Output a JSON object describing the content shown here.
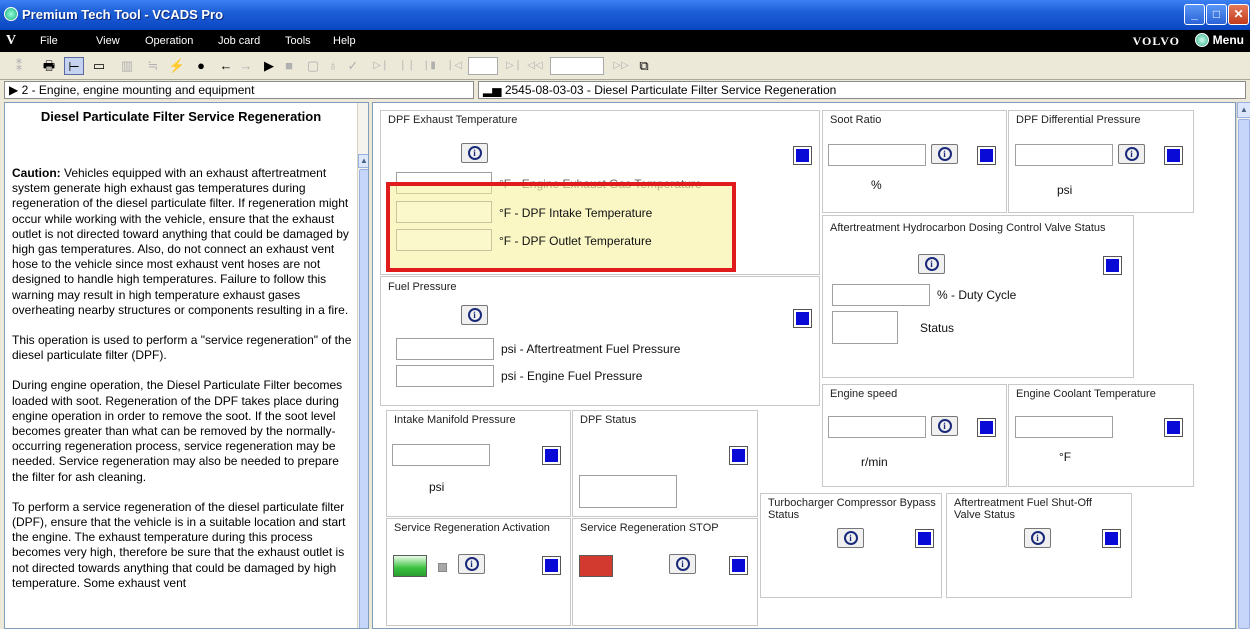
{
  "window": {
    "title": "Premium Tech Tool - VCADS Pro",
    "controls": {
      "minimize": "_",
      "maximize": "□",
      "close": "✕"
    }
  },
  "menubar": {
    "logo": "V",
    "items": [
      "File",
      "View",
      "Operation",
      "Job card",
      "Tools",
      "Help"
    ],
    "brand": "VOLVO",
    "menu_button": "Menu"
  },
  "breadcrumb": {
    "left": "2 - Engine, engine mounting and equipment",
    "right": "2545-08-03-03 - Diesel Particulate Filter Service Regeneration"
  },
  "description": {
    "title": "Diesel Particulate Filter Service Regeneration",
    "caution_label": "Caution:",
    "caution_text": " Vehicles equipped with an exhaust aftertreatment system generate high exhaust gas temperatures during regeneration of the diesel particulate filter. If regeneration might occur while working with the vehicle, ensure that the exhaust outlet is not directed toward anything that could be damaged by high gas temperatures. Also, do not connect an exhaust vent hose to the vehicle since most exhaust vent hoses are not designed to handle high temperatures. Failure to follow this warning may result in high temperature exhaust gases overheating nearby structures or components resulting in a fire.",
    "para2": "This operation is used to perform a \"service regeneration\" of the diesel particulate filter (DPF).",
    "para3": "During engine operation, the Diesel Particulate Filter becomes loaded with soot. Regeneration of the DPF takes place during engine operation in order to remove the soot. If the soot level becomes greater than what can be removed by the normally-occurring regeneration process, service regeneration may be needed. Service regeneration may also be needed to prepare the filter for ash cleaning.",
    "para4": "To perform a service regeneration of the diesel particulate filter (DPF), ensure that the vehicle is in a suitable location and start the engine. The exhaust temperature during this process becomes very high, therefore be sure that the exhaust outlet is not directed towards anything that could be damaged by high temperature. Some exhaust vent"
  },
  "panels": {
    "dpf_exhaust": {
      "title": "DPF Exhaust Temperature",
      "engine_label": "°F - Engine Exhaust Gas Temperature",
      "intake_label": "°F - DPF Intake Temperature",
      "outlet_label": "°F - DPF Outlet Temperature"
    },
    "soot_ratio": {
      "title": "Soot Ratio",
      "unit": "%"
    },
    "dpf_diff": {
      "title": "DPF Differential Pressure",
      "unit": "psi"
    },
    "hc_dosing": {
      "title": "Aftertreatment Hydrocarbon Dosing Control Valve Status",
      "duty_label": "% - Duty Cycle",
      "status_label": "Status"
    },
    "fuel_pressure": {
      "title": "Fuel Pressure",
      "aftertreatment_label": "psi - Aftertreatment Fuel Pressure",
      "engine_label": "psi - Engine Fuel Pressure"
    },
    "engine_speed": {
      "title": "Engine speed",
      "unit": "r/min"
    },
    "coolant": {
      "title": "Engine Coolant Temperature",
      "unit": "°F"
    },
    "intake_manifold": {
      "title": "Intake Manifold Pressure",
      "unit": "psi"
    },
    "dpf_status": {
      "title": "DPF Status"
    },
    "turbo_bypass": {
      "title": "Turbocharger Compressor Bypass Status"
    },
    "fuel_shutoff": {
      "title": "Aftertreatment Fuel Shut-Off Valve Status"
    },
    "service_regen": {
      "title": "Service Regeneration Activation"
    },
    "service_stop": {
      "title": "Service Regeneration STOP"
    }
  },
  "colors": {
    "indicator_blue": "#0a0ad6",
    "highlight_border": "#e01b1b",
    "start_green": "#39c23f",
    "stop_red": "#d23a30"
  }
}
